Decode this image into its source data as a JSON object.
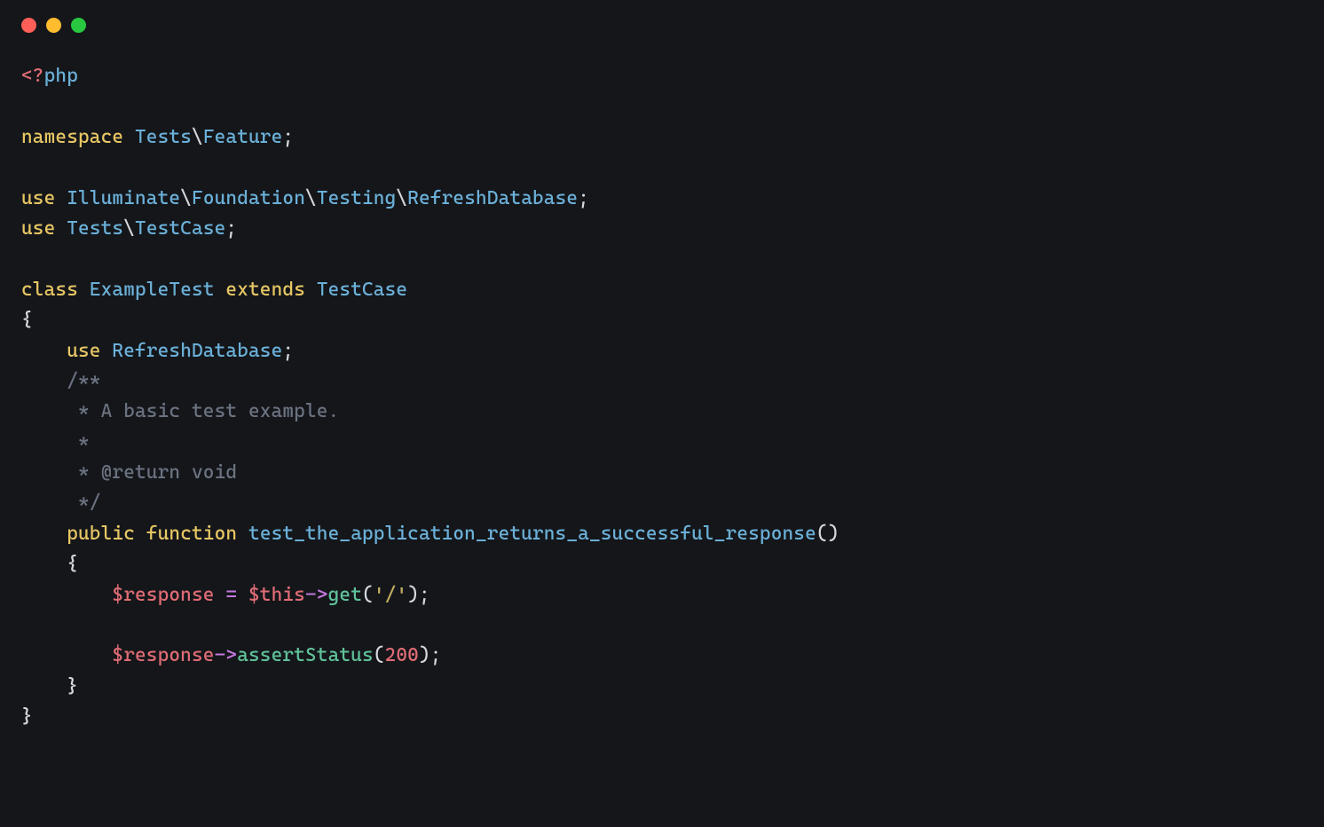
{
  "window": {
    "traffic": {
      "red": "#ff5f57",
      "yellow": "#febc2e",
      "green": "#28c840"
    }
  },
  "code": {
    "php_open_tag": "<?",
    "php_word": "php",
    "kw_namespace": "namespace",
    "ns_tests": "Tests",
    "ns_sep": "\\",
    "ns_feature": "Feature",
    "kw_use": "use",
    "ill": "Illuminate",
    "foundation": "Foundation",
    "testing": "Testing",
    "refreshdb": "RefreshDatabase",
    "tests": "Tests",
    "testcase": "TestCase",
    "kw_class": "class",
    "class_name": "ExampleTest",
    "kw_extends": "extends",
    "comment_open": "/**",
    "comment_line1": " * A basic test example.",
    "comment_line2": " *",
    "comment_line3": " * @return void",
    "comment_close": " */",
    "kw_public": "public",
    "kw_function": "function",
    "fn_name": "test_the_application_returns_a_successful_response",
    "var_response": "$response",
    "var_this": "$this",
    "call_get": "get",
    "str_root": "'/'",
    "call_assert": "assertStatus",
    "num_200": "200",
    "brace_open": "{",
    "brace_close": "}",
    "paren_open": "(",
    "paren_close": ")",
    "semicolon": ";",
    "eq": " = ",
    "arrow": "->"
  }
}
